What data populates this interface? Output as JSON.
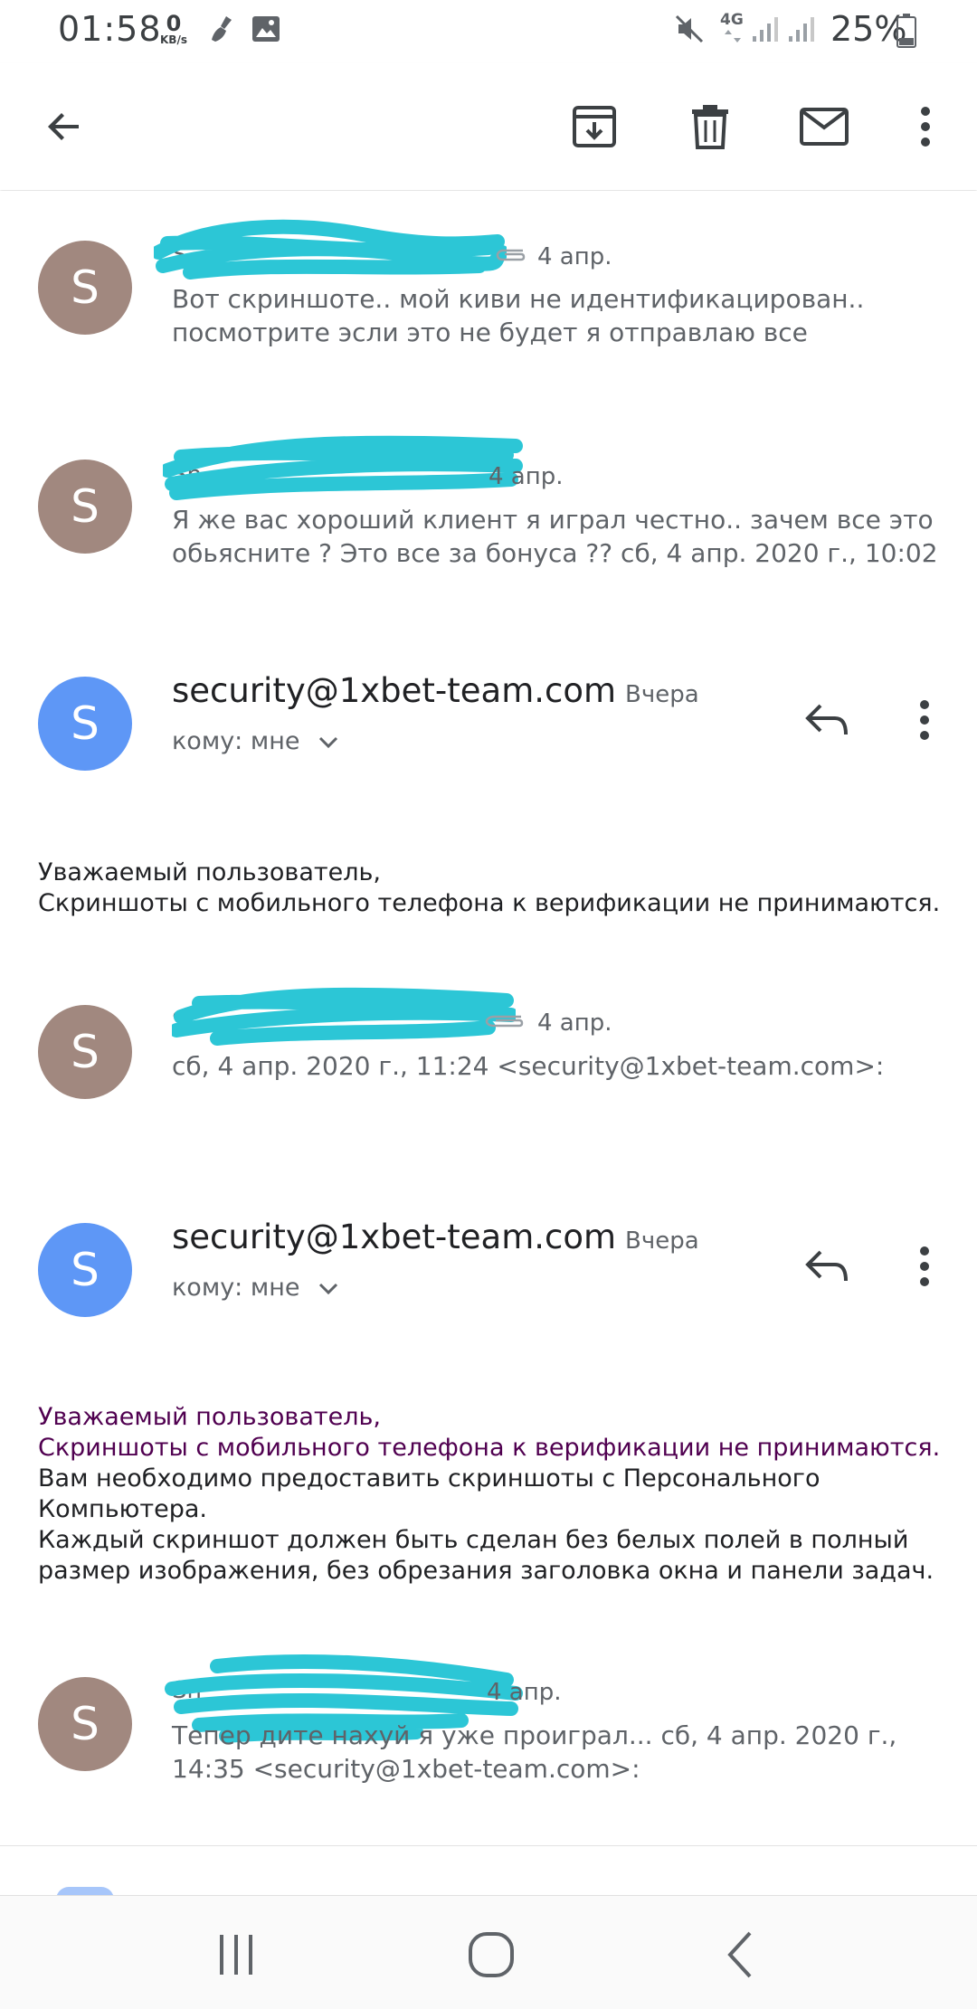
{
  "status_bar": {
    "time": "01:58",
    "speed_value": "0",
    "speed_unit": "KB/s",
    "network": "4G",
    "battery": "25%"
  },
  "toolbar": {
    "icons": [
      "back-arrow-icon",
      "archive-icon",
      "delete-icon",
      "mail-icon",
      "more-vert-icon"
    ]
  },
  "messages": [
    {
      "sender": "S",
      "date": "4 апр.",
      "avatar_letter": "S",
      "snippet": "Вот скриншоте.. мой киви не идентификацирован.. посмотрите эсли это не будет я отправлаю все"
    },
    {
      "sender": "Sh",
      "date": "4 апр.",
      "avatar_letter": "S",
      "snippet": "Я же вас хороший клиент я играл честно.. зачем все это обьясните ? Это все за бонуса ?? сб, 4 апр. 2020 г., 10:02"
    },
    {
      "from": "security@1xbet-team.com",
      "date": "Вчера",
      "to": "кому: мне",
      "avatar_letter": "S",
      "body_lines": [
        "Уважаемый пользователь,",
        "Скриншоты с мобильного телефона к верификации не принимаются."
      ]
    },
    {
      "sender": "S",
      "date": "4 апр.",
      "avatar_letter": "S",
      "snippet": "сб, 4 апр. 2020 г., 11:24 <security@1xbet-team.com>:"
    },
    {
      "from": "security@1xbet-team.com",
      "date": "Вчера",
      "to": "кому: мне",
      "avatar_letter": "S",
      "quoted_lines": [
        "Уважаемый пользователь,",
        "Скриншоты с мобильного телефона к верификации не принимаются."
      ],
      "body_lines": [
        "Вам необходимо предоставить скриншоты с Персонального Компьютера.",
        "Каждый скриншот должен быть сделан без белых полей в полный размер изображения, без обрезания заголовка окна и панели задач."
      ]
    },
    {
      "sender": "Sh",
      "date": "4 апр.",
      "avatar_letter": "S",
      "snippet": "Тепер дите нахуй я уже проиграл... сб, 4 апр. 2020 г., 14:35 <security@1xbet-team.com>:"
    }
  ],
  "colors": {
    "avatar_brown": "#a1887f",
    "avatar_blue": "#5e97f6",
    "scribble": "#2cc6d6",
    "quoted_text": "#500050"
  }
}
